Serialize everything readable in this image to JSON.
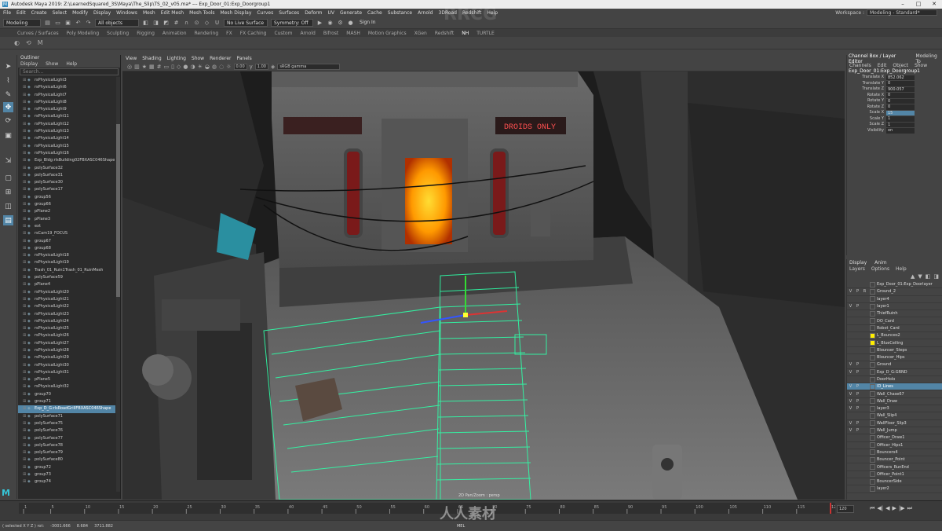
{
  "window": {
    "title": "Autodesk Maya 2019: Z:\\LearnedSquared_3S\\Maya\\The_Slip\\TS_02_v05.ma* --- Exp_Door_01:Exp_Doorgroup1"
  },
  "menus": [
    "File",
    "Edit",
    "Create",
    "Select",
    "Modify",
    "Display",
    "Windows",
    "Mesh",
    "Edit Mesh",
    "Mesh Tools",
    "Mesh Display",
    "Curves",
    "Surfaces",
    "Deform",
    "UV",
    "Generate",
    "Cache",
    "Substance",
    "Arnold",
    "3DRoad",
    "Redshift",
    "Help"
  ],
  "workspace": {
    "label": "Workspace :",
    "value": "Modeling - Standard*"
  },
  "statusline": {
    "mode": "Modeling",
    "select_mode": "All objects",
    "live_surface": "No Live Surface",
    "symmetry": "Symmetry: Off",
    "signin": "Sign In"
  },
  "shelf_tabs": [
    "Curves / Surfaces",
    "Poly Modeling",
    "Sculpting",
    "Rigging",
    "Animation",
    "Rendering",
    "FX",
    "FX Caching",
    "Custom",
    "Arnold",
    "Bifrost",
    "MASH",
    "Motion Graphics",
    "XGen",
    "Redshift",
    "NH",
    "TURTLE"
  ],
  "shelf_active": "NH",
  "outliner": {
    "title": "Outliner",
    "menu": [
      "Display",
      "Show",
      "Help"
    ],
    "search_placeholder": "Search...",
    "items": [
      "rsPhysicalLight3",
      "rsPhysicalLight6",
      "rsPhysicalLight7",
      "rsPhysicalLight8",
      "rsPhysicalLight9",
      "rsPhysicalLight11",
      "rsPhysicalLight12",
      "rsPhysicalLight13",
      "rsPhysicalLight14",
      "rsPhysicalLight15",
      "rsPhysicalLight16",
      "Exp_Bldg:rlsBuilding02FBXASC046Shape",
      "polySurface32",
      "polySurface31",
      "polySurface30",
      "polySurface17",
      "group56",
      "group66",
      "pPlane2",
      "pPlane3",
      "ext",
      "rsCam19_FOCUS",
      "group67",
      "group68",
      "rsPhysicalLight18",
      "rsPhysicalLight19",
      "Trash_01_Ruin1Trash_01_RuinMesh",
      "polySurface59",
      "pPlane4",
      "rsPhysicalLight20",
      "rsPhysicalLight21",
      "rsPhysicalLight22",
      "rsPhysicalLight23",
      "rsPhysicalLight24",
      "rsPhysicalLight25",
      "rsPhysicalLight26",
      "rsPhysicalLight27",
      "rsPhysicalLight28",
      "rsPhysicalLight29",
      "rsPhysicalLight30",
      "rsPhysicalLight31",
      "pPlane5",
      "rsPhysicalLight32",
      "group70",
      "group71",
      "Exp_D_G:rlsRoadGrillFBXASC046Shape",
      "polySurface71",
      "polySurface75",
      "polySurface76",
      "polySurface77",
      "polySurface78",
      "polySurface79",
      "polySurface80",
      "group72",
      "group73",
      "group74"
    ],
    "selected_index": 45
  },
  "viewport": {
    "menu": [
      "View",
      "Shading",
      "Lighting",
      "Show",
      "Renderer",
      "Panels"
    ],
    "exposure": "0.00",
    "gamma": "1.00",
    "colorspace": "sRGB gamma",
    "camera_label": "2D Pan/Zoom : persp",
    "sign_text": "DROIDS ONLY"
  },
  "channelbox": {
    "tabs": [
      "Channel Box / Layer Editor",
      "Modeling To"
    ],
    "menu": [
      "Channels",
      "Edit",
      "Object",
      "Show"
    ],
    "object": "Exp_Door_01:Exp_Doorgroup1",
    "channels": [
      {
        "name": "Translate X",
        "value": "852.062"
      },
      {
        "name": "Translate Y",
        "value": "0"
      },
      {
        "name": "Translate Z",
        "value": "900.057"
      },
      {
        "name": "Rotate X",
        "value": "0"
      },
      {
        "name": "Rotate Y",
        "value": "0"
      },
      {
        "name": "Rotate Z",
        "value": "0"
      },
      {
        "name": "Scale X",
        "value": "15"
      },
      {
        "name": "Scale Y",
        "value": "1"
      },
      {
        "name": "Scale Z",
        "value": "1"
      },
      {
        "name": "Visibility",
        "value": "on"
      }
    ]
  },
  "layers": {
    "tabs": [
      "Display",
      "Anim"
    ],
    "menu": [
      "Layers",
      "Options",
      "Help"
    ],
    "items": [
      {
        "v": "",
        "p": "",
        "r": "",
        "name": "Exp_Door_01:Exp_Doorlayer",
        "color": ""
      },
      {
        "v": "V",
        "p": "P",
        "r": "R",
        "name": "Ground_2",
        "color": ""
      },
      {
        "v": "",
        "p": "",
        "r": "",
        "name": "layer4",
        "color": ""
      },
      {
        "v": "V",
        "p": "P",
        "r": "",
        "name": "layer1",
        "color": ""
      },
      {
        "v": "",
        "p": "",
        "r": "",
        "name": "ThiefRuinh",
        "color": ""
      },
      {
        "v": "",
        "p": "",
        "r": "",
        "name": "DO_Card",
        "color": ""
      },
      {
        "v": "",
        "p": "",
        "r": "",
        "name": "Robot_Card",
        "color": ""
      },
      {
        "v": "",
        "p": "",
        "r": "",
        "name": "L_Bounces2",
        "color": "#ffee00"
      },
      {
        "v": "",
        "p": "",
        "r": "",
        "name": "L_BlueCeiling",
        "color": "#ffee00"
      },
      {
        "v": "",
        "p": "",
        "r": "",
        "name": "Blounser_Steps",
        "color": ""
      },
      {
        "v": "",
        "p": "",
        "r": "",
        "name": "Blouncer_Hips",
        "color": ""
      },
      {
        "v": "V",
        "p": "P",
        "r": "",
        "name": "Ground",
        "color": ""
      },
      {
        "v": "V",
        "p": "P",
        "r": "",
        "name": "Exp_D_G:GRND",
        "color": ""
      },
      {
        "v": "",
        "p": "",
        "r": "",
        "name": "DoorHolo",
        "color": ""
      },
      {
        "v": "V",
        "p": "P",
        "r": "",
        "name": "ID_Lines",
        "color": ""
      },
      {
        "v": "V",
        "p": "P",
        "r": "",
        "name": "Wall_Chase67",
        "color": ""
      },
      {
        "v": "V",
        "p": "P",
        "r": "",
        "name": "Wall_Draw",
        "color": ""
      },
      {
        "v": "V",
        "p": "P",
        "r": "",
        "name": "layer3",
        "color": ""
      },
      {
        "v": "",
        "p": "",
        "r": "",
        "name": "Wall_Slip4",
        "color": ""
      },
      {
        "v": "V",
        "p": "P",
        "r": "",
        "name": "WallFloor_Slip3",
        "color": ""
      },
      {
        "v": "V",
        "p": "P",
        "r": "",
        "name": "Wall_Jump",
        "color": ""
      },
      {
        "v": "",
        "p": "",
        "r": "",
        "name": "Officer_Draw1",
        "color": ""
      },
      {
        "v": "",
        "p": "",
        "r": "",
        "name": "Officer_Hips1",
        "color": ""
      },
      {
        "v": "",
        "p": "",
        "r": "",
        "name": "Bouncers4",
        "color": ""
      },
      {
        "v": "",
        "p": "",
        "r": "",
        "name": "Bouncer_Point",
        "color": ""
      },
      {
        "v": "",
        "p": "",
        "r": "",
        "name": "Officers_RunEnd",
        "color": ""
      },
      {
        "v": "",
        "p": "",
        "r": "",
        "name": "Officer_Point1",
        "color": ""
      },
      {
        "v": "",
        "p": "",
        "r": "",
        "name": "BouncerSide",
        "color": ""
      },
      {
        "v": "",
        "p": "",
        "r": "",
        "name": "layer2",
        "color": ""
      }
    ],
    "selected_index": 14
  },
  "timeline": {
    "ticks": [
      "1",
      "5",
      "10",
      "15",
      "20",
      "25",
      "30",
      "35",
      "40",
      "45",
      "50",
      "55",
      "60",
      "65",
      "70",
      "75",
      "80",
      "85",
      "90",
      "95",
      "100",
      "105",
      "110",
      "115",
      "120"
    ],
    "end_frame": "120",
    "current": "120"
  },
  "cmdline": {
    "left_text": "( selected X Y Z ) rot:",
    "values": [
      "-3001.666",
      "8.684",
      "3711.882"
    ],
    "mel": "MEL"
  },
  "watermark": {
    "brand": "RRCG",
    "cn": "人人素材"
  }
}
